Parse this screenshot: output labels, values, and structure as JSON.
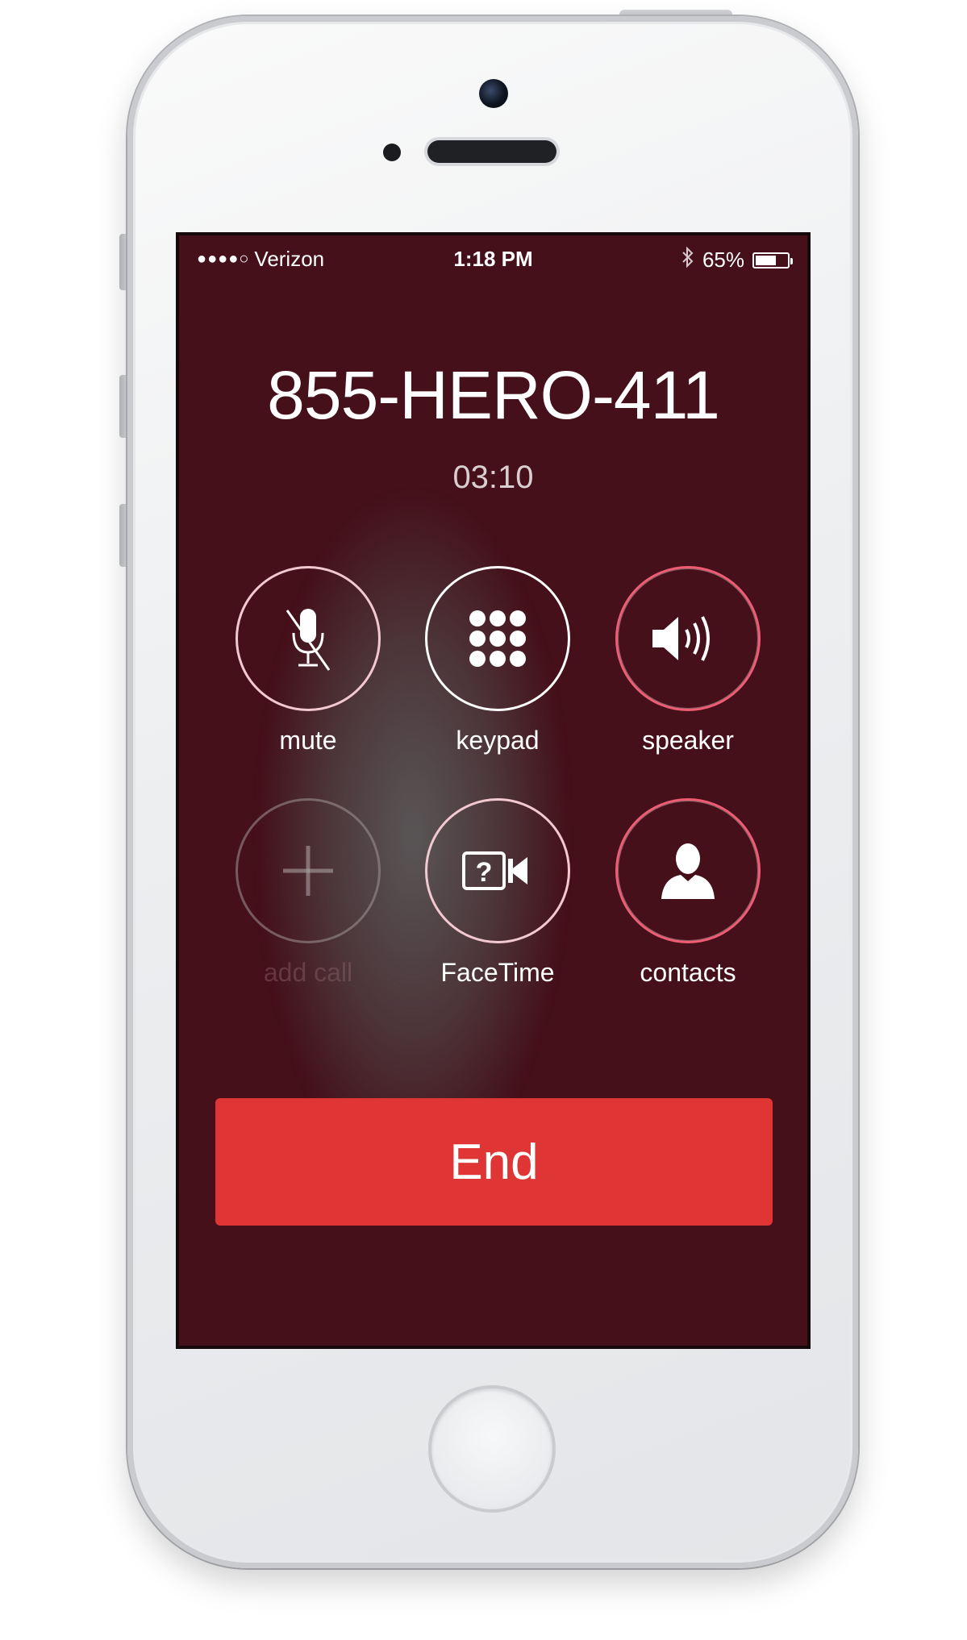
{
  "status": {
    "carrier": "Verizon",
    "signal": "●●●●○",
    "time": "1:18 PM",
    "battery_percent": "65%",
    "battery_level": 0.65
  },
  "call": {
    "number": "855-HERO-411",
    "duration": "03:10"
  },
  "buttons": {
    "mute": "mute",
    "keypad": "keypad",
    "speaker": "speaker",
    "add_call": "add call",
    "facetime": "FaceTime",
    "contacts": "contacts"
  },
  "end_label": "End",
  "icons": {
    "bluetooth": "bluetooth-icon",
    "battery": "battery-icon",
    "mute": "microphone-slash-icon",
    "keypad": "keypad-grid-icon",
    "speaker": "speaker-icon",
    "add_call": "plus-icon",
    "facetime": "facetime-camera-icon",
    "contacts": "person-icon"
  },
  "colors": {
    "screen_bg": "#45101a",
    "end_button": "#e03535",
    "button_ring": "#ee5d73"
  }
}
